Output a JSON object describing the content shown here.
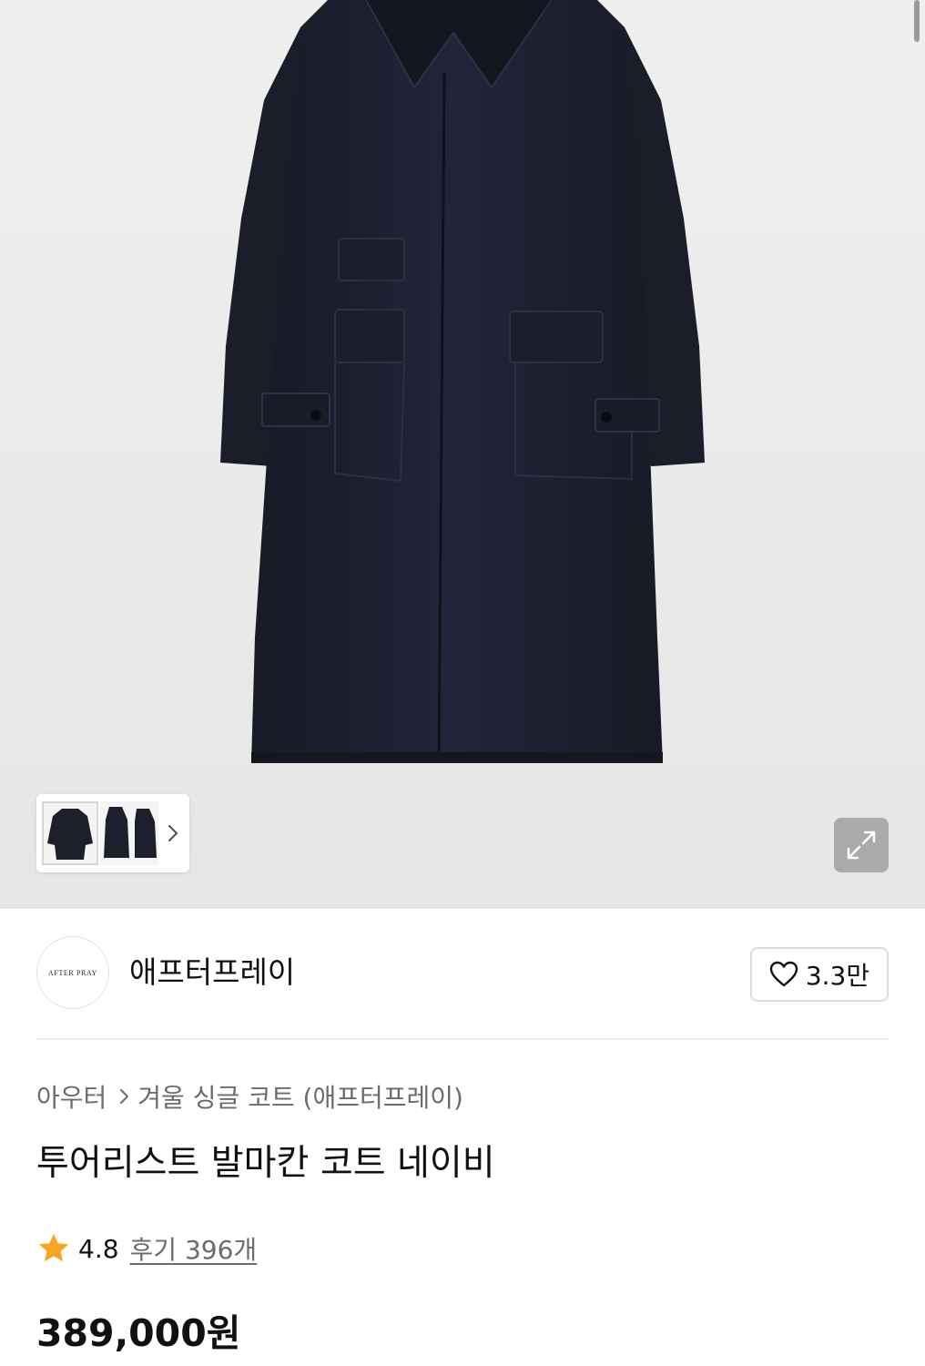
{
  "product_image": {
    "thumbnail_icons": [
      "coat-front-thumbnail",
      "coat-side-thumbnail",
      "coat-back-thumbnail"
    ],
    "expand_icon": "expand-arrows-icon"
  },
  "brand": {
    "logo_text": "AFTER PRAY",
    "name": "애프터프레이",
    "like_count": "3.3만"
  },
  "breadcrumb": {
    "category": "아우터",
    "subcategory": "겨울 싱글 코트 (애프터프레이)"
  },
  "product": {
    "title": "투어리스트 발마칸 코트 네이비",
    "rating": "4.8",
    "review_label": "후기 396개",
    "price": "389,000원"
  },
  "colors": {
    "coat": "#1d1f2b",
    "star": "#f5a623"
  }
}
